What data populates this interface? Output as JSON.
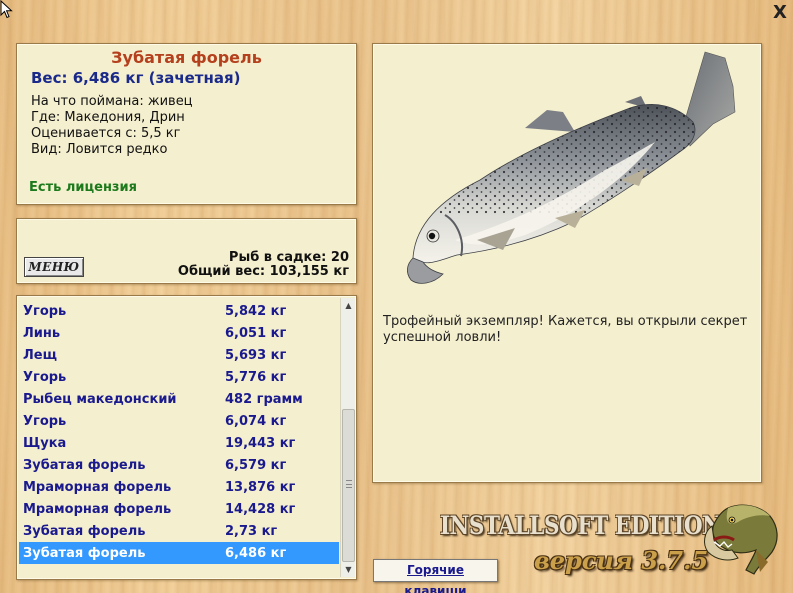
{
  "window": {
    "close_glyph": "X"
  },
  "info": {
    "title": "Зубатая форель",
    "weight": "Вес: 6,486 кг (зачетная)",
    "details": [
      "На что поймана: живец",
      "Где: Македония, Дрин",
      "Оценивается с: 5,5 кг",
      "Вид: Ловится редко"
    ],
    "license": "Есть лицензия"
  },
  "stats": {
    "menu_label": "МЕНЮ",
    "fish_in_cage": "Рыб в садке: 20",
    "total_weight": "Общий вес: 103,155 кг"
  },
  "catch_list": {
    "rows": [
      {
        "name": "Угорь",
        "weight": "5,842 кг"
      },
      {
        "name": "Линь",
        "weight": "6,051 кг"
      },
      {
        "name": "Лещ",
        "weight": "5,693 кг"
      },
      {
        "name": "Угорь",
        "weight": "5,776 кг"
      },
      {
        "name": "Рыбец македонский",
        "weight": "482 грамм"
      },
      {
        "name": "Угорь",
        "weight": "6,074 кг"
      },
      {
        "name": "Щука",
        "weight": "19,443 кг"
      },
      {
        "name": "Зубатая форель",
        "weight": "6,579 кг"
      },
      {
        "name": "Мраморная форель",
        "weight": "13,876 кг"
      },
      {
        "name": "Мраморная форель",
        "weight": "14,428 кг"
      },
      {
        "name": "Зубатая форель",
        "weight": "2,73 кг"
      },
      {
        "name": "Зубатая форель",
        "weight": "6,486 кг"
      }
    ],
    "selected_index": 11
  },
  "fish_panel": {
    "comment": "Трофейный экземпляр! Кажется, вы открыли секрет успешной ловли!"
  },
  "hotkeys_label": "Горячие клавиши",
  "branding": {
    "edition": "INSTALLSOFT EDITION",
    "version": "версия 3.7.5"
  },
  "colors": {
    "title": "#b5401d",
    "weight": "#1a2a8a",
    "license": "#1c7a1c",
    "list_text": "#1a1a8e",
    "selection": "#3399ff",
    "panel_bg": "#f4efcf"
  }
}
